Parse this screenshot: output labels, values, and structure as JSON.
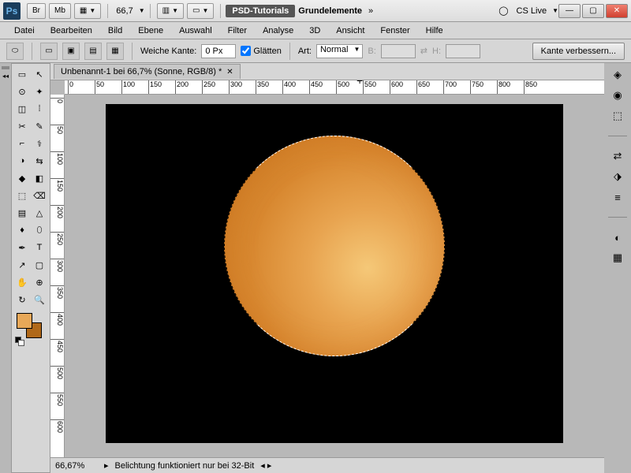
{
  "titlebar": {
    "ps": "Ps",
    "br": "Br",
    "mb": "Mb",
    "zoom": "66,7",
    "tut": "PSD-Tutorials",
    "grund": "Grundelemente",
    "cslive": "CS Live"
  },
  "menu": [
    "Datei",
    "Bearbeiten",
    "Bild",
    "Ebene",
    "Auswahl",
    "Filter",
    "Analyse",
    "3D",
    "Ansicht",
    "Fenster",
    "Hilfe"
  ],
  "opt": {
    "weiche": "Weiche Kante:",
    "weiche_val": "0 Px",
    "glatten": "Glätten",
    "art": "Art:",
    "art_val": "Normal",
    "b": "B:",
    "h": "H:",
    "kante": "Kante verbessern..."
  },
  "doc": {
    "tab": "Unbenannt-1 bei 66,7% (Sonne, RGB/8) *"
  },
  "status": {
    "zoom": "66,67%",
    "msg": "Belichtung funktioniert nur bei 32-Bit"
  },
  "ruler_h": [
    0,
    50,
    100,
    150,
    200,
    250,
    300,
    350,
    400,
    450,
    500,
    550,
    600,
    650,
    700,
    750,
    800,
    850
  ],
  "ruler_v": [
    0,
    50,
    100,
    150,
    200,
    250,
    300,
    350,
    400,
    450,
    500,
    550,
    600
  ],
  "tools": [
    "▭",
    "↖",
    "⊙",
    "✦",
    "◫",
    "⁞",
    "✂",
    "✎",
    "⌐",
    "⚕",
    "◑",
    "⇆",
    "◆",
    "◧",
    "⬚",
    "⌫",
    "▤",
    "△",
    "♦",
    "⬯",
    "✒",
    "T",
    "↗",
    "▢",
    "✋",
    "⊕",
    "↻",
    "🔍"
  ]
}
